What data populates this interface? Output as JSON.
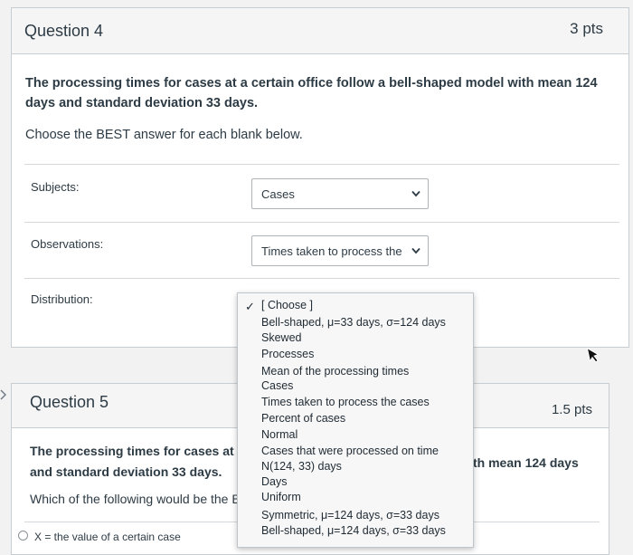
{
  "question4": {
    "title": "Question 4",
    "points": "3 pts",
    "prompt": "The processing times for cases at a certain office follow a bell-shaped model with mean 124 days and standard deviation 33 days.",
    "instruction": "Choose the BEST answer for each blank below.",
    "rows": [
      {
        "label": "Subjects:",
        "selected": "Cases"
      },
      {
        "label": "Observations:",
        "selected": "Times taken to process the c"
      },
      {
        "label": "Distribution:",
        "selected": "[ Choose ]"
      }
    ]
  },
  "dropdown": {
    "check": "✓",
    "options": [
      "[ Choose ]",
      "Bell-shaped, μ=33 days, σ=124 days",
      "Skewed",
      "Processes",
      "Mean of the processing times",
      "Cases",
      "Times taken to process the cases",
      "Percent of cases",
      "Normal",
      "Cases that were processed on time",
      "N(124, 33) days",
      "Days",
      "Uniform",
      "Symmetric, μ=124 days, σ=33 days",
      "Bell-shaped, μ=124 days, σ=33 days"
    ]
  },
  "question5": {
    "title": "Question 5",
    "points": "1.5 pts",
    "prompt_left_1": "The processing times for cases at a ce",
    "prompt_left_2": "and standard deviation 33 days.",
    "prompt_right": "th mean 124 days",
    "question": "Which of the following would be the B",
    "option_partial": "X = the value of a certain case"
  },
  "icons": {
    "chevron": "chevron-down-icon",
    "check": "check-icon",
    "collapse": "chevron-left-icon"
  }
}
